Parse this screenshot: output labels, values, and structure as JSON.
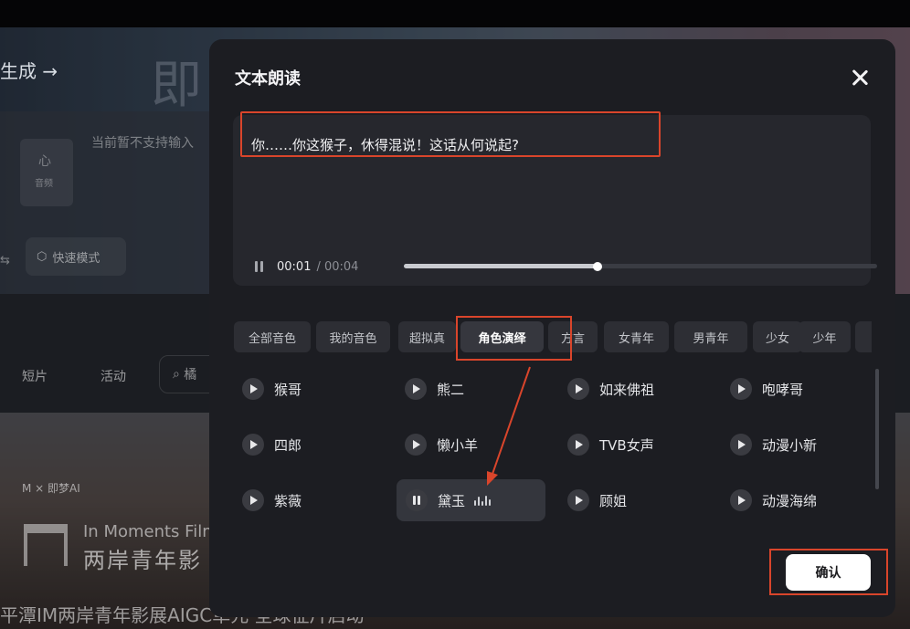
{
  "background": {
    "generate_link": "生成 →",
    "big_char": "即",
    "card_top": "心",
    "card_sub": "音频",
    "hint": "当前暂不支持输入",
    "dash": "⇆",
    "fast_mode": "快速模式",
    "nav_items": [
      "短片",
      "活动"
    ],
    "search_partial": "橘",
    "logos": "M × 即梦AI",
    "film_en": "In Moments Film",
    "film_zh": "两岸青年影",
    "bottom_caption": "平潭IM两岸青年影展AIGC单元·全球征片启动"
  },
  "modal": {
    "title": "文本朗读",
    "text": "你……你这猴子，休得混说！这话从何说起?",
    "player": {
      "current_time": "00:01",
      "total_time": "/ 00:04",
      "progress": 0.41
    },
    "tabs": [
      {
        "label": "全部音色",
        "active": false
      },
      {
        "label": "我的音色",
        "active": false
      },
      {
        "label": "超拟真",
        "active": false
      },
      {
        "label": "角色演绎",
        "active": true
      },
      {
        "label": "方言",
        "active": false
      },
      {
        "label": "女青年",
        "active": false
      },
      {
        "label": "男青年",
        "active": false
      },
      {
        "label": "少女",
        "active": false
      },
      {
        "label": "少年",
        "active": false
      },
      {
        "label": "",
        "active": false
      }
    ],
    "voices": [
      {
        "label": "猴哥",
        "state": "play"
      },
      {
        "label": "熊二",
        "state": "play"
      },
      {
        "label": "如来佛祖",
        "state": "play"
      },
      {
        "label": "咆哮哥",
        "state": "play"
      },
      {
        "label": "四郎",
        "state": "play"
      },
      {
        "label": "懒小羊",
        "state": "play"
      },
      {
        "label": "TVB女声",
        "state": "play"
      },
      {
        "label": "动漫小新",
        "state": "play"
      },
      {
        "label": "紫薇",
        "state": "play"
      },
      {
        "label": "黛玉",
        "state": "playing",
        "selected": true
      },
      {
        "label": "顾姐",
        "state": "play"
      },
      {
        "label": "动漫海绵",
        "state": "play"
      }
    ],
    "confirm_label": "确认"
  },
  "colors": {
    "annotation": "#d9452b",
    "modal_bg": "#1c1d22",
    "confirm_bg": "#ffffff"
  }
}
